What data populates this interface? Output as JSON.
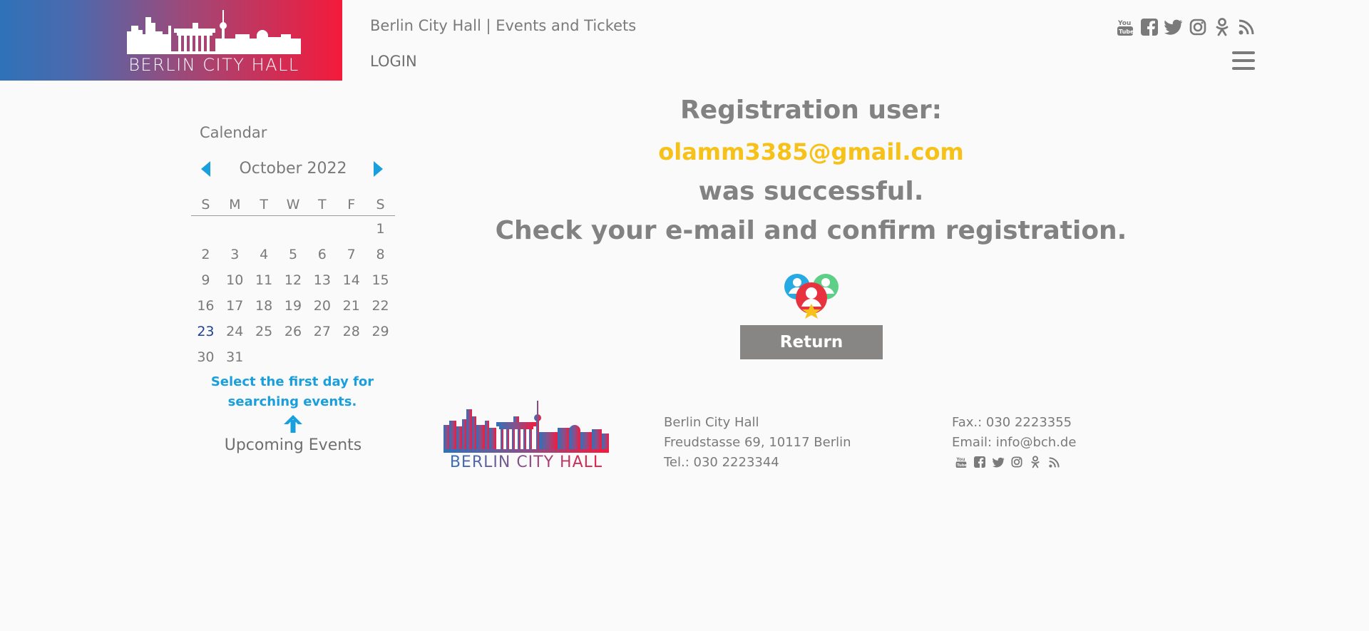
{
  "header": {
    "logo_text": "BERLIN CITY HALL",
    "site_title": "Berlin City Hall | Events and Tickets",
    "login_label": "LOGIN",
    "social_icons": [
      "youtube-icon",
      "facebook-icon",
      "twitter-icon",
      "instagram-icon",
      "odnoklassniki-icon",
      "rss-icon"
    ]
  },
  "calendar": {
    "title": "Calendar",
    "month_label": "October 2022",
    "weekdays": [
      "S",
      "M",
      "T",
      "W",
      "T",
      "F",
      "S"
    ],
    "days": [
      "",
      "",
      "",
      "",
      "",
      "",
      "1",
      "2",
      "3",
      "4",
      "5",
      "6",
      "7",
      "8",
      "9",
      "10",
      "11",
      "12",
      "13",
      "14",
      "15",
      "16",
      "17",
      "18",
      "19",
      "20",
      "21",
      "22",
      "23",
      "24",
      "25",
      "26",
      "27",
      "28",
      "29",
      "30",
      "31"
    ],
    "today": "23",
    "hint": "Select the first day for searching events.",
    "upcoming_label": "Upcoming Events"
  },
  "message": {
    "line1": "Registration user:",
    "email": "olamm3385@gmail.com",
    "line3": "was successful.",
    "line4": "Check your e-mail and confirm registration.",
    "return_label": "Return"
  },
  "footer": {
    "logo_text": "BERLIN CITY HALL",
    "name": "Berlin City Hall",
    "address": "Freudstasse 69, 10117 Berlin",
    "tel": "Tel.: 030 2223344",
    "fax": "Fax.: 030 2223355",
    "email": "Email: info@bch.de"
  },
  "colors": {
    "accent_blue": "#1a9fdd",
    "email_yellow": "#f6c219",
    "button_gray": "#878685",
    "gradient_start": "#2f72b8",
    "gradient_end": "#f41a3b"
  }
}
